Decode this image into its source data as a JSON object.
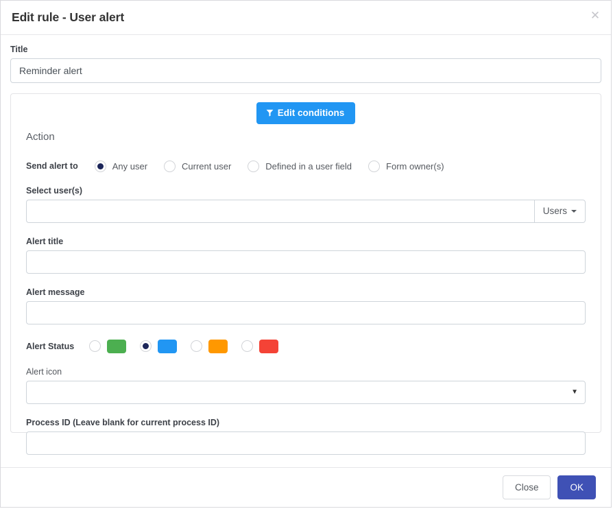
{
  "dialog": {
    "title": "Edit rule - User alert",
    "close_icon": "close-icon"
  },
  "title_field": {
    "label": "Title",
    "value": "Reminder alert",
    "placeholder": ""
  },
  "conditions": {
    "button_label": "Edit conditions",
    "icon": "filter-funnel-icon",
    "color": "#2196f3"
  },
  "action": {
    "heading": "Action",
    "send_alert_to": {
      "label": "Send alert to",
      "options": [
        {
          "label": "Any user",
          "checked": true
        },
        {
          "label": "Current user",
          "checked": false
        },
        {
          "label": "Defined in a user field",
          "checked": false
        },
        {
          "label": "Form owner(s)",
          "checked": false
        }
      ],
      "selected_color": "#1b2559"
    },
    "select_users": {
      "label": "Select user(s)",
      "value": "",
      "placeholder": "",
      "addon_label": "Users",
      "addon_icon": "chevron-down-icon"
    },
    "alert_title": {
      "label": "Alert title",
      "value": "",
      "placeholder": ""
    },
    "alert_message": {
      "label": "Alert message",
      "value": "",
      "placeholder": ""
    },
    "alert_status": {
      "label": "Alert Status",
      "options": [
        {
          "color": "#4caf50",
          "name": "green",
          "checked": false
        },
        {
          "color": "#2196f3",
          "name": "blue",
          "checked": true
        },
        {
          "color": "#ff9800",
          "name": "orange",
          "checked": false
        },
        {
          "color": "#f44336",
          "name": "red",
          "checked": false
        }
      ]
    },
    "alert_icon": {
      "label": "Alert icon",
      "value": "",
      "options": [
        ""
      ],
      "arrow_icon": "caret-down-icon"
    },
    "process_id": {
      "label": "Process ID (Leave blank for current process ID)",
      "value": "",
      "placeholder": ""
    }
  },
  "footer": {
    "close_label": "Close",
    "ok_label": "OK",
    "ok_color": "#3f51b5"
  }
}
